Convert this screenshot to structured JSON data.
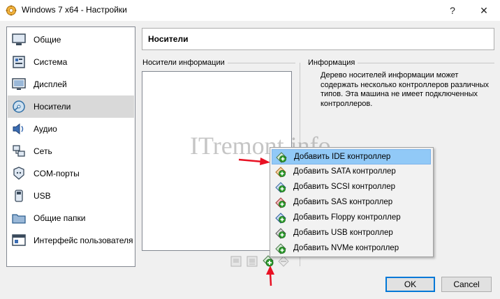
{
  "window": {
    "title": "Windows 7 x64 - Настройки",
    "help_glyph": "?",
    "close_glyph": "✕"
  },
  "sidebar": {
    "items": [
      {
        "label": "Общие",
        "icon": "general-icon"
      },
      {
        "label": "Система",
        "icon": "system-icon"
      },
      {
        "label": "Дисплей",
        "icon": "display-icon"
      },
      {
        "label": "Носители",
        "icon": "storage-icon",
        "selected": true
      },
      {
        "label": "Аудио",
        "icon": "audio-icon"
      },
      {
        "label": "Сеть",
        "icon": "network-icon"
      },
      {
        "label": "COM-порты",
        "icon": "serial-port-icon"
      },
      {
        "label": "USB",
        "icon": "usb-icon"
      },
      {
        "label": "Общие папки",
        "icon": "shared-folder-icon"
      },
      {
        "label": "Интерфейс пользователя",
        "icon": "user-interface-icon"
      }
    ]
  },
  "page": {
    "title": "Носители"
  },
  "storage_tree": {
    "label": "Носители информации"
  },
  "info": {
    "label": "Информация",
    "text": "Дерево носителей информации может содержать несколько контроллеров различных типов. Эта машина не имеет подключенных контроллеров."
  },
  "watermark": "ITremont.info",
  "context_menu": {
    "items": [
      {
        "label": "Добавить IDE контроллер",
        "highlighted": true
      },
      {
        "label": "Добавить SATA контроллер"
      },
      {
        "label": "Добавить SCSI контроллер"
      },
      {
        "label": "Добавить SAS контроллер"
      },
      {
        "label": "Добавить Floppy контроллер"
      },
      {
        "label": "Добавить USB контроллер"
      },
      {
        "label": "Добавить NVMe контроллер"
      }
    ]
  },
  "buttons": {
    "ok": "OK",
    "cancel": "Cancel"
  },
  "colors": {
    "menu_highlight": "#91c9f7",
    "arrow": "#e81123",
    "add_icon": "#2e9e2e"
  }
}
